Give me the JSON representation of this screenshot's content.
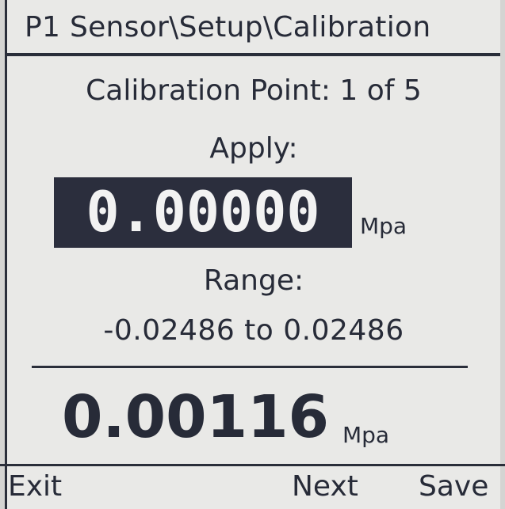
{
  "header": {
    "title": "P1 Sensor\\Setup\\Calibration"
  },
  "calibration": {
    "point_text": "Calibration Point: 1 of 5",
    "apply_label": "Apply:",
    "apply_value": "0.00000",
    "apply_unit": "Mpa",
    "range_label": "Range:",
    "range_value": "-0.02486 to 0.02486",
    "live_value": "0.00116",
    "live_unit": "Mpa"
  },
  "softkeys": {
    "exit": "Exit",
    "next": "Next",
    "save": "Save"
  },
  "colors": {
    "background": "#e9e9e7",
    "foreground": "#272b38",
    "highlight_bg": "#2b2e3d",
    "highlight_fg": "#f2f2f2"
  }
}
